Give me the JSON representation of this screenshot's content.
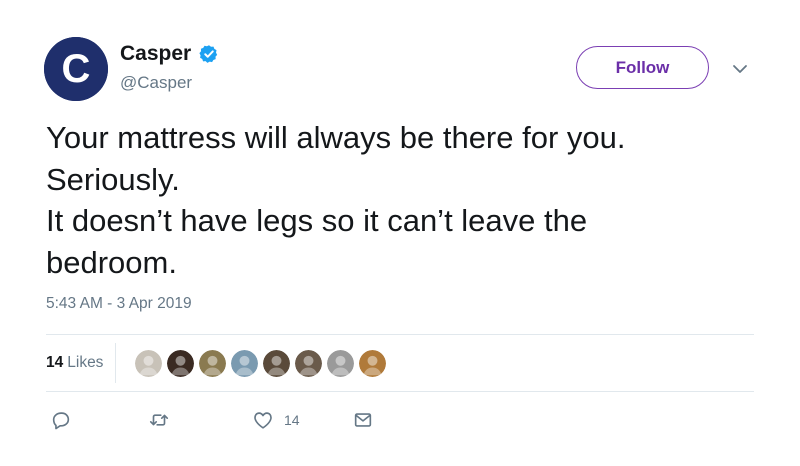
{
  "author": {
    "display_name": "Casper",
    "handle": "@Casper",
    "verified": true,
    "avatar_letter": "C"
  },
  "follow_label": "Follow",
  "tweet": {
    "lines": [
      "Your mattress will always be there for you.",
      "Seriously.",
      "It doesn’t have legs so it can’t leave the",
      "bedroom."
    ],
    "timestamp": "5:43 AM - 3 Apr 2019"
  },
  "likes": {
    "count": "14",
    "label": "Likes",
    "avatar_colors": [
      "#c8c2b8",
      "#3a2a22",
      "#8a7a50",
      "#7a9ab0",
      "#5a4a3a",
      "#6a5a4a",
      "#9a9a9a",
      "#b07a3a"
    ]
  },
  "actions": {
    "like_count": "14"
  },
  "colors": {
    "brand": "#1f2f6c",
    "follow": "#6b2fa8",
    "verified": "#1da1f2",
    "muted": "#657786"
  },
  "icons": [
    "verified-icon",
    "chevron-down-icon",
    "reply-icon",
    "retweet-icon",
    "heart-icon",
    "message-icon"
  ]
}
